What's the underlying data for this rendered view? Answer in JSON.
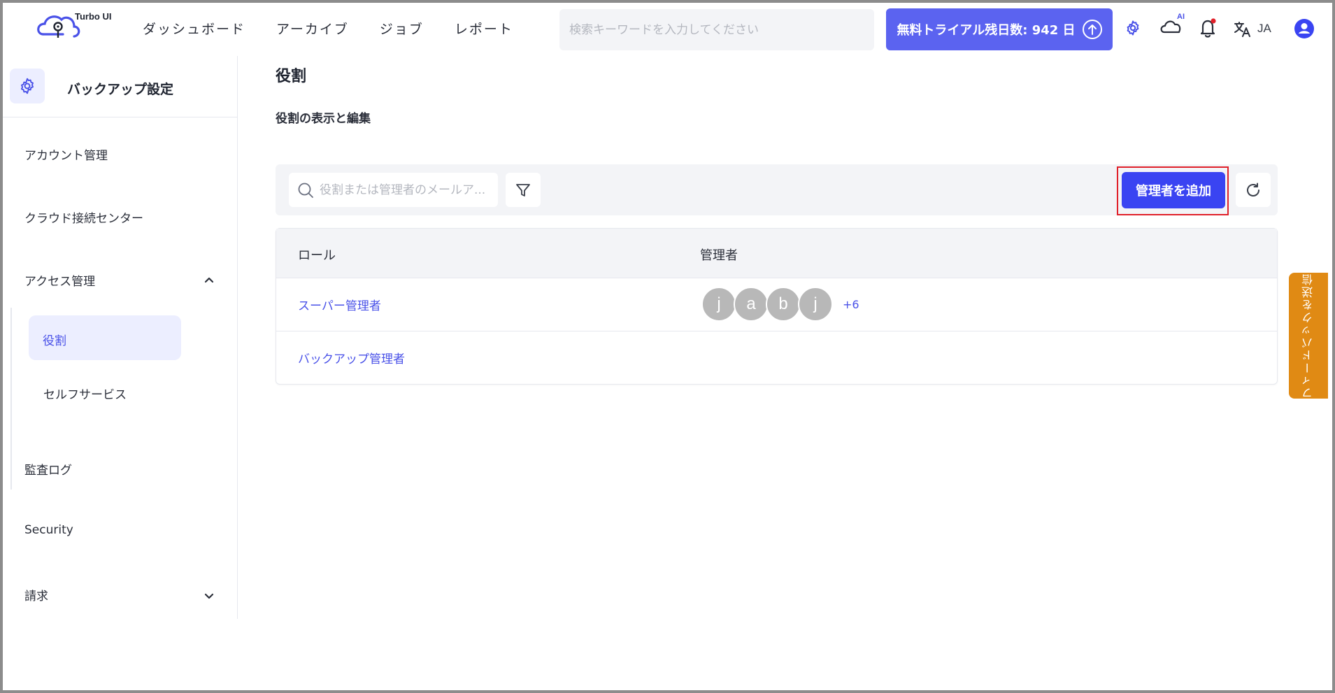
{
  "app": {
    "logo_text": "Turbo UI"
  },
  "nav": {
    "items": [
      {
        "label": "ダッシュボード"
      },
      {
        "label": "アーカイブ"
      },
      {
        "label": "ジョブ"
      },
      {
        "label": "レポート"
      }
    ]
  },
  "header": {
    "search_placeholder": "検索キーワードを入力してください",
    "trial_label": "無料トライアル残日数: 942 日",
    "ai_badge": "AI",
    "language": "JA",
    "accent_color": "#5b63f0",
    "notification_dot_color": "#e0202a"
  },
  "sidebar": {
    "title": "バックアップ設定",
    "items": [
      {
        "label": "アカウント管理"
      },
      {
        "label": "クラウド接続センター"
      },
      {
        "label": "アクセス管理",
        "expanded": true
      },
      {
        "label": "監査ログ"
      },
      {
        "label": "Security"
      },
      {
        "label": "請求",
        "expanded": false
      }
    ],
    "sub_items": [
      {
        "label": "役割",
        "active": true
      },
      {
        "label": "セルフサービス"
      }
    ]
  },
  "main": {
    "page_title": "役割",
    "section_title": "役割の表示と編集",
    "search_placeholder": "役割または管理者のメールア...",
    "add_button_label": "管理者を追加",
    "table": {
      "columns": [
        "ロール",
        "管理者"
      ],
      "rows": [
        {
          "role": "スーパー管理者",
          "admins": [
            "j",
            "a",
            "b",
            "j"
          ],
          "more": "+6"
        },
        {
          "role": "バックアップ管理者",
          "admins": [],
          "more": ""
        }
      ]
    }
  },
  "feedback": {
    "label": "フィードバックを送信",
    "color": "#e08a14"
  }
}
